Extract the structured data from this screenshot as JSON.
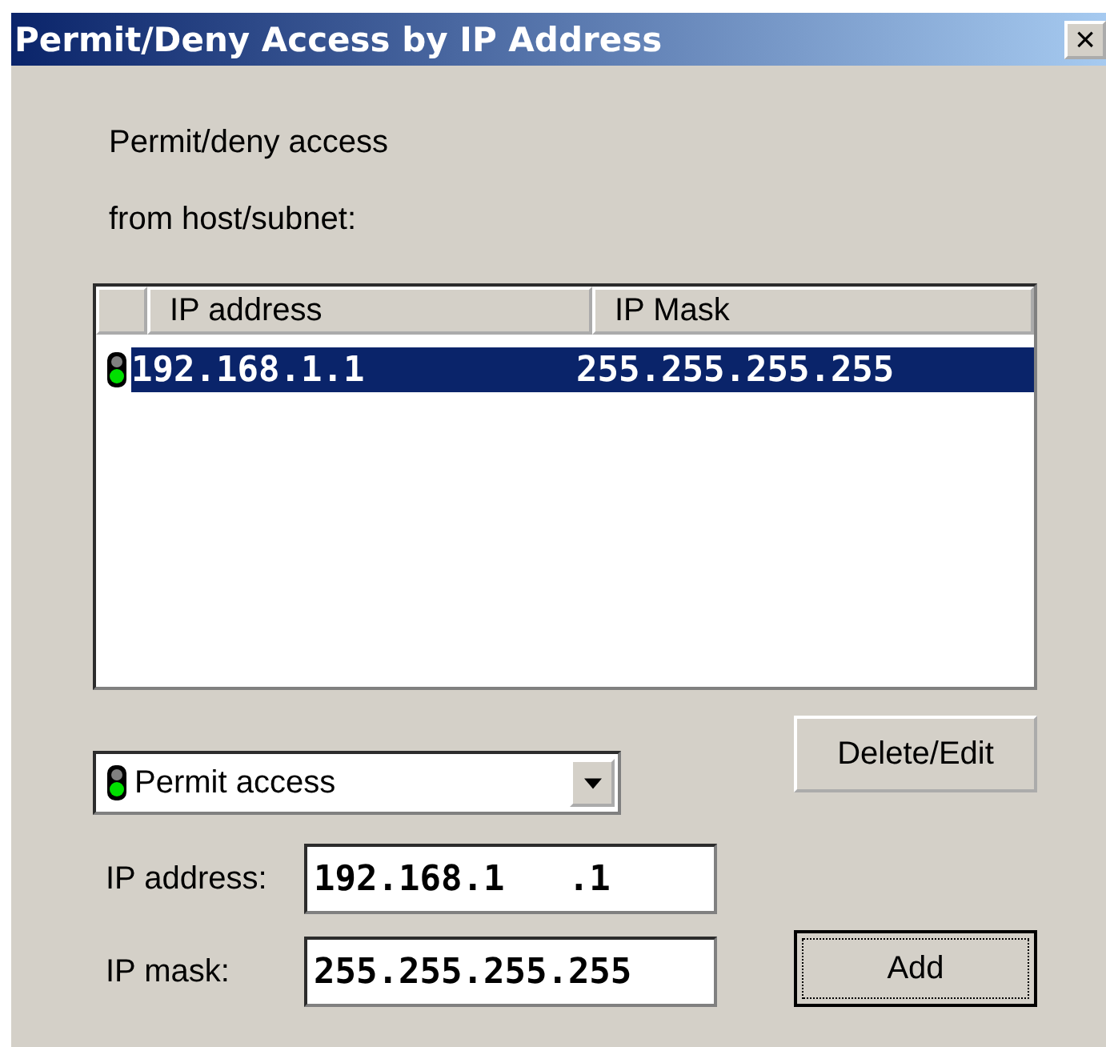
{
  "window": {
    "title": "Permit/Deny Access by IP Address",
    "close": "×"
  },
  "intro": [
    "Permit/deny access",
    "from host/subnet:"
  ],
  "table": {
    "columns": [
      "IP address",
      "IP Mask"
    ],
    "rows": [
      {
        "kind": "permit",
        "ip": "192.168.1.1",
        "mask": "255.255.255.255",
        "selected": true
      }
    ]
  },
  "access_select": {
    "kind": "permit",
    "value": "Permit access"
  },
  "delete_button": "Delete/Edit",
  "fields": [
    {
      "label": "IP address:",
      "value": "192.168.1   .1"
    },
    {
      "label": "IP mask:",
      "value": "255.255.255.255"
    }
  ],
  "add_button": "Add"
}
